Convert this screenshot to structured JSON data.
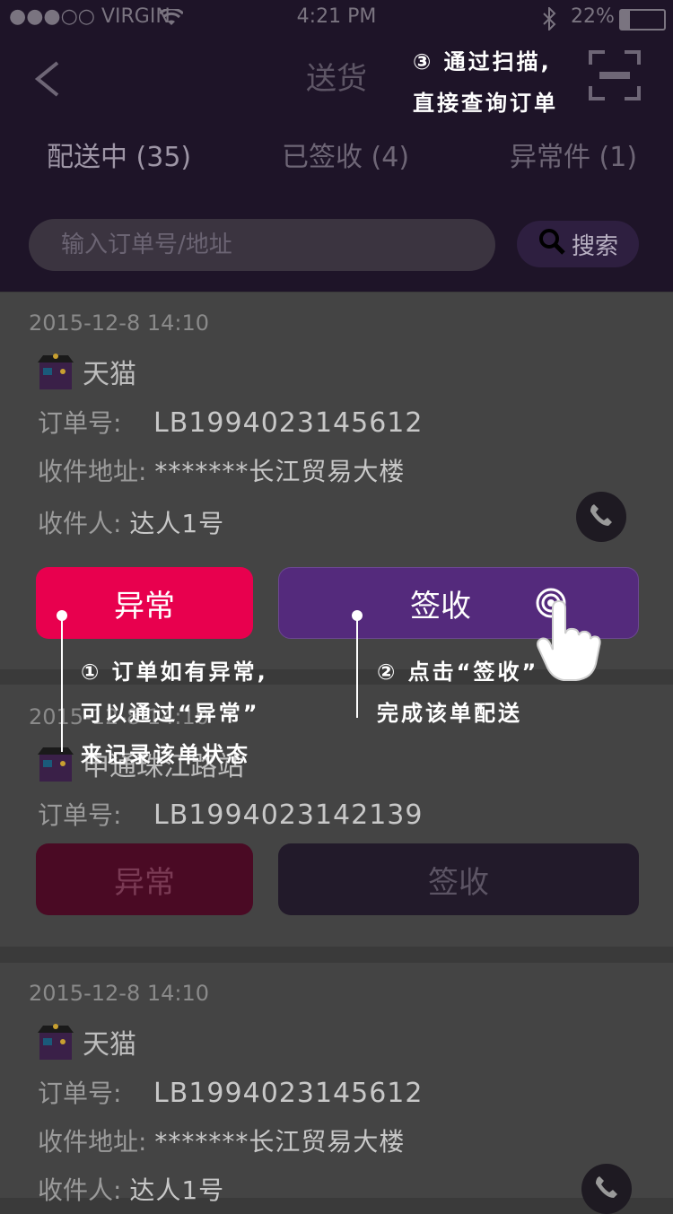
{
  "status_bar": {
    "carrier": "●●●○○ VIRGIN",
    "time": "4:21 PM",
    "battery": "22%"
  },
  "nav": {
    "title": "送货",
    "back_icon": "chevron-left-icon",
    "scan_icon": "scan-frame-icon"
  },
  "tabs": [
    {
      "label": "配送中 (35)"
    },
    {
      "label": "已签收 (4)"
    },
    {
      "label": "异常件 (1)"
    }
  ],
  "search": {
    "placeholder": "输入订单号/地址",
    "button_label": "搜索"
  },
  "orders": [
    {
      "date": "2015-12-8 14:10",
      "store": "天猫",
      "order_label": "订单号:",
      "order_no": "LB1994023145612",
      "address_label": "收件地址:",
      "address": "*******长江贸易大楼",
      "receiver_label": "收件人:",
      "receiver": "达人1号",
      "abnormal_label": "异常",
      "sign_label": "签收"
    },
    {
      "date": "2015-12-8 14:10",
      "store": "申通珠江路站",
      "order_label": "订单号:",
      "order_no": "LB1994023142139",
      "abnormal_label": "异常",
      "sign_label": "签收"
    },
    {
      "date": "2015-12-8 14:10",
      "store": "天猫",
      "order_label": "订单号:",
      "order_no": "LB1994023145612",
      "address_label": "收件地址:",
      "address": "*******长江贸易大楼",
      "receiver_label": "收件人:",
      "receiver": "达人1号"
    }
  ],
  "annotations": {
    "scan_line1": "③ 通过扫描,",
    "scan_line2": "直接查询订单",
    "abnormal_line1": "① 订单如有异常,",
    "abnormal_line2": "可以通过“异常”",
    "abnormal_line3": "来记录该单状态",
    "sign_line1": "② 点击“签收”",
    "sign_line2": "完成该单配送"
  },
  "colors": {
    "header_bg": "#1e1428",
    "abnormal_red": "#e8004e",
    "sign_purple": "#542a7c"
  }
}
